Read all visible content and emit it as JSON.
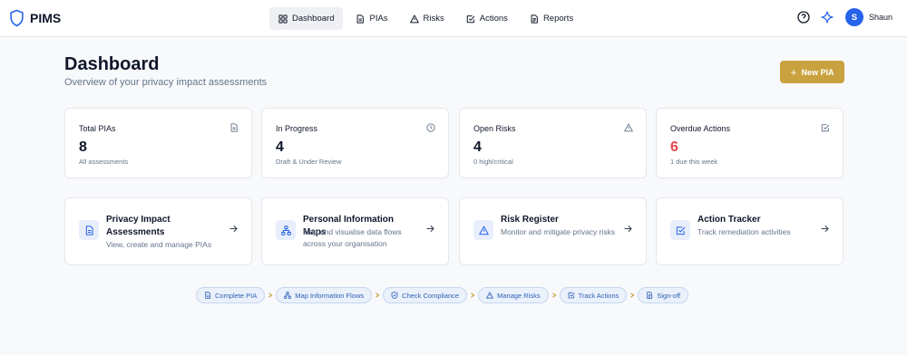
{
  "app": {
    "name": "PIMS"
  },
  "nav": {
    "items": [
      {
        "label": "Dashboard",
        "icon": "dashboard-icon",
        "active": true
      },
      {
        "label": "PIAs",
        "icon": "document-icon"
      },
      {
        "label": "Risks",
        "icon": "warning-icon"
      },
      {
        "label": "Actions",
        "icon": "checkbox-icon"
      },
      {
        "label": "Reports",
        "icon": "report-icon"
      }
    ]
  },
  "user": {
    "initial": "S",
    "name": "Shaun"
  },
  "header": {
    "title": "Dashboard",
    "subtitle": "Overview of your privacy impact assessments",
    "new_button": "New PIA"
  },
  "stats": [
    {
      "label": "Total PIAs",
      "value": "8",
      "sub": "All assessments",
      "icon": "document-icon"
    },
    {
      "label": "In Progress",
      "value": "4",
      "sub": "Draft & Under Review",
      "icon": "clock-icon"
    },
    {
      "label": "Open Risks",
      "value": "4",
      "sub": "0 high/critical",
      "icon": "warning-icon"
    },
    {
      "label": "Overdue Actions",
      "value": "6",
      "sub": "1 due this week",
      "icon": "checkbox-icon",
      "value_color": "#e5484d"
    }
  ],
  "features": [
    {
      "title": "Privacy Impact Assessments",
      "desc": "View, create and manage PIAs",
      "icon": "document-icon"
    },
    {
      "title": "Personal Information Maps",
      "desc": "Map and visualise data flows across your organisation",
      "icon": "network-icon"
    },
    {
      "title": "Risk Register",
      "desc": "Monitor and mitigate privacy risks",
      "icon": "warning-icon"
    },
    {
      "title": "Action Tracker",
      "desc": "Track remediation activities",
      "icon": "checkbox-icon"
    }
  ],
  "workflow": [
    {
      "label": "Complete PIA",
      "icon": "document-icon"
    },
    {
      "label": "Map Information Flows",
      "icon": "network-icon"
    },
    {
      "label": "Check Compliance",
      "icon": "shield-check-icon"
    },
    {
      "label": "Manage Risks",
      "icon": "warning-icon"
    },
    {
      "label": "Track Actions",
      "icon": "checkbox-icon"
    },
    {
      "label": "Sign-off",
      "icon": "report-icon"
    }
  ],
  "colors": {
    "accent": "#2563eb",
    "primary_button": "#c9a23f",
    "danger": "#e5484d",
    "chip_bg": "#eaf1fb",
    "chip_text": "#2f5fb3"
  }
}
